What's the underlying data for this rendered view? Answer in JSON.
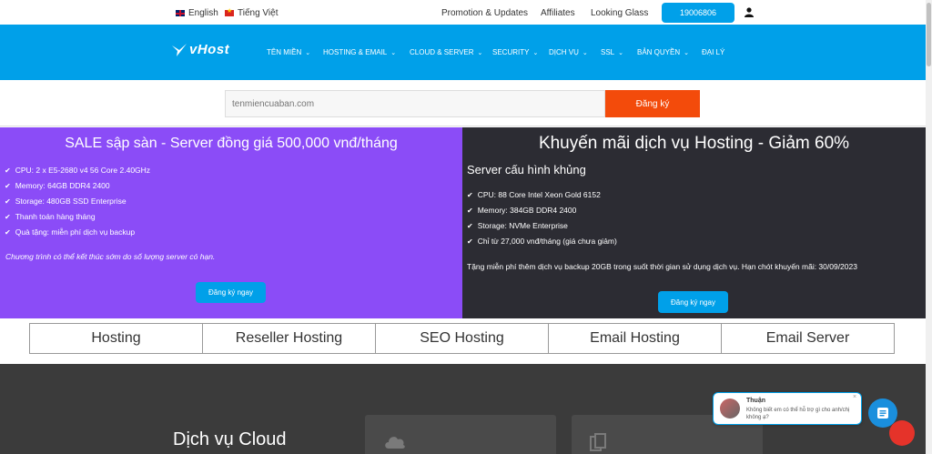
{
  "topbar": {
    "lang_en": "English",
    "lang_vi": "Tiếng Việt",
    "links": [
      "Promotion & Updates",
      "Affiliates",
      "Looking Glass"
    ],
    "phone": "19006806"
  },
  "nav": {
    "logo_text": "vHost",
    "items": [
      "TÊN MIỀN",
      "HOSTING & EMAIL",
      "CLOUD & SERVER",
      "SECURITY",
      "DỊCH VỤ",
      "SSL",
      "BẢN QUYỀN",
      "ĐẠI LÝ"
    ]
  },
  "search": {
    "placeholder": "tenmiencuaban.com",
    "button": "Đăng ký"
  },
  "promo_left": {
    "title": "SALE sập sàn - Server đồng giá 500,000 vnđ/tháng",
    "features": [
      "CPU: 2 x E5-2680 v4 56 Core 2.40GHz",
      "Memory: 64GB DDR4 2400",
      "Storage: 480GB SSD Enterprise",
      "Thanh toán hàng tháng",
      "Quà tặng: miễn phí dịch vụ backup"
    ],
    "note": "Chương trình có thể kết thúc sớm do số lượng server có hạn.",
    "cta": "Đăng ký ngay"
  },
  "promo_right": {
    "title": "Khuyến mãi dịch vụ Hosting - Giảm 60%",
    "subtitle": "Server cấu hình khủng",
    "features": [
      "CPU: 88 Core Intel Xeon Gold 6152",
      "Memory: 384GB DDR4 2400",
      "Storage: NVMe Enterprise",
      "Chỉ từ 27,000 vnđ/tháng (giá chưa giảm)"
    ],
    "note": "Tặng miễn phí thêm dịch vụ backup 20GB trong suốt thời gian sử dụng dịch vụ. Hạn chót khuyến mãi: 30/09/2023",
    "cta": "Đăng ký ngay"
  },
  "tabs": [
    "Hosting",
    "Reseller Hosting",
    "SEO Hosting",
    "Email Hosting",
    "Email Server"
  ],
  "cloud": {
    "title": "Dịch vụ Cloud"
  },
  "chat": {
    "name": "Thuận",
    "message": "Không biết em có thể hỗ trợ gì cho anh/chị không ạ?",
    "close": "×"
  },
  "colors": {
    "brand": "#00a0e9",
    "promo_left_bg": "#8b4cf7",
    "promo_right_bg": "#2c2c33",
    "search_btn": "#f34b0b"
  }
}
